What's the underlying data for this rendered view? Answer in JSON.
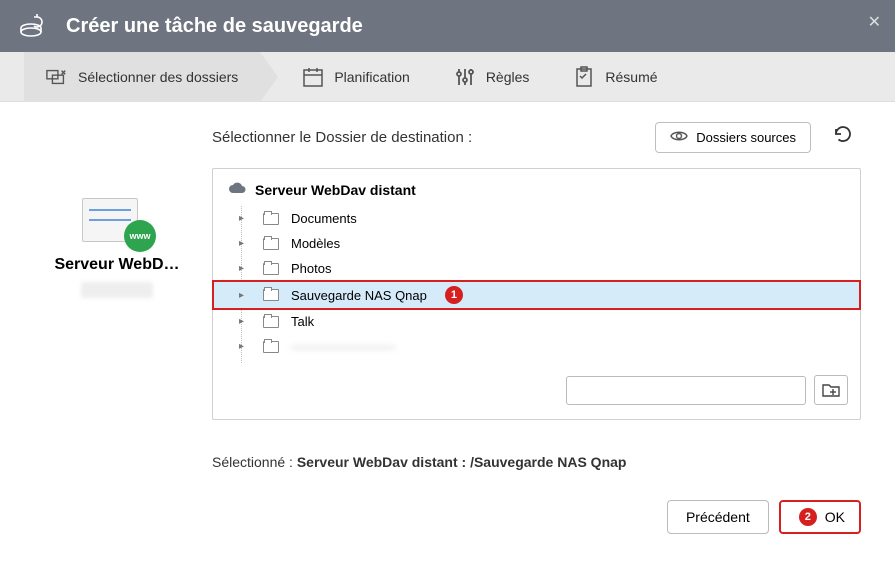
{
  "header": {
    "title": "Créer une tâche de sauvegarde"
  },
  "steps": [
    {
      "label": "Sélectionner des dossiers"
    },
    {
      "label": "Planification"
    },
    {
      "label": "Règles"
    },
    {
      "label": "Résumé"
    }
  ],
  "left_panel": {
    "server_name": "Serveur WebD…",
    "globe_text": "www"
  },
  "main": {
    "select_dest_label": "Sélectionner le Dossier de destination :",
    "sources_button": "Dossiers sources",
    "tree_root": "Serveur WebDav distant",
    "folders": [
      {
        "label": "Documents",
        "selected": false,
        "blurred": false
      },
      {
        "label": "Modèles",
        "selected": false,
        "blurred": false
      },
      {
        "label": "Photos",
        "selected": false,
        "blurred": false
      },
      {
        "label": "Sauvegarde NAS Qnap",
        "selected": true,
        "blurred": false
      },
      {
        "label": "Talk",
        "selected": false,
        "blurred": false
      },
      {
        "label": "————————",
        "selected": false,
        "blurred": true
      }
    ],
    "path_input_value": "",
    "selected_prefix": "Sélectionné : ",
    "selected_path": "Serveur WebDav distant : /Sauvegarde NAS Qnap"
  },
  "footer": {
    "prev": "Précédent",
    "ok": "OK"
  },
  "annotations": {
    "badge1": "1",
    "badge2": "2"
  }
}
